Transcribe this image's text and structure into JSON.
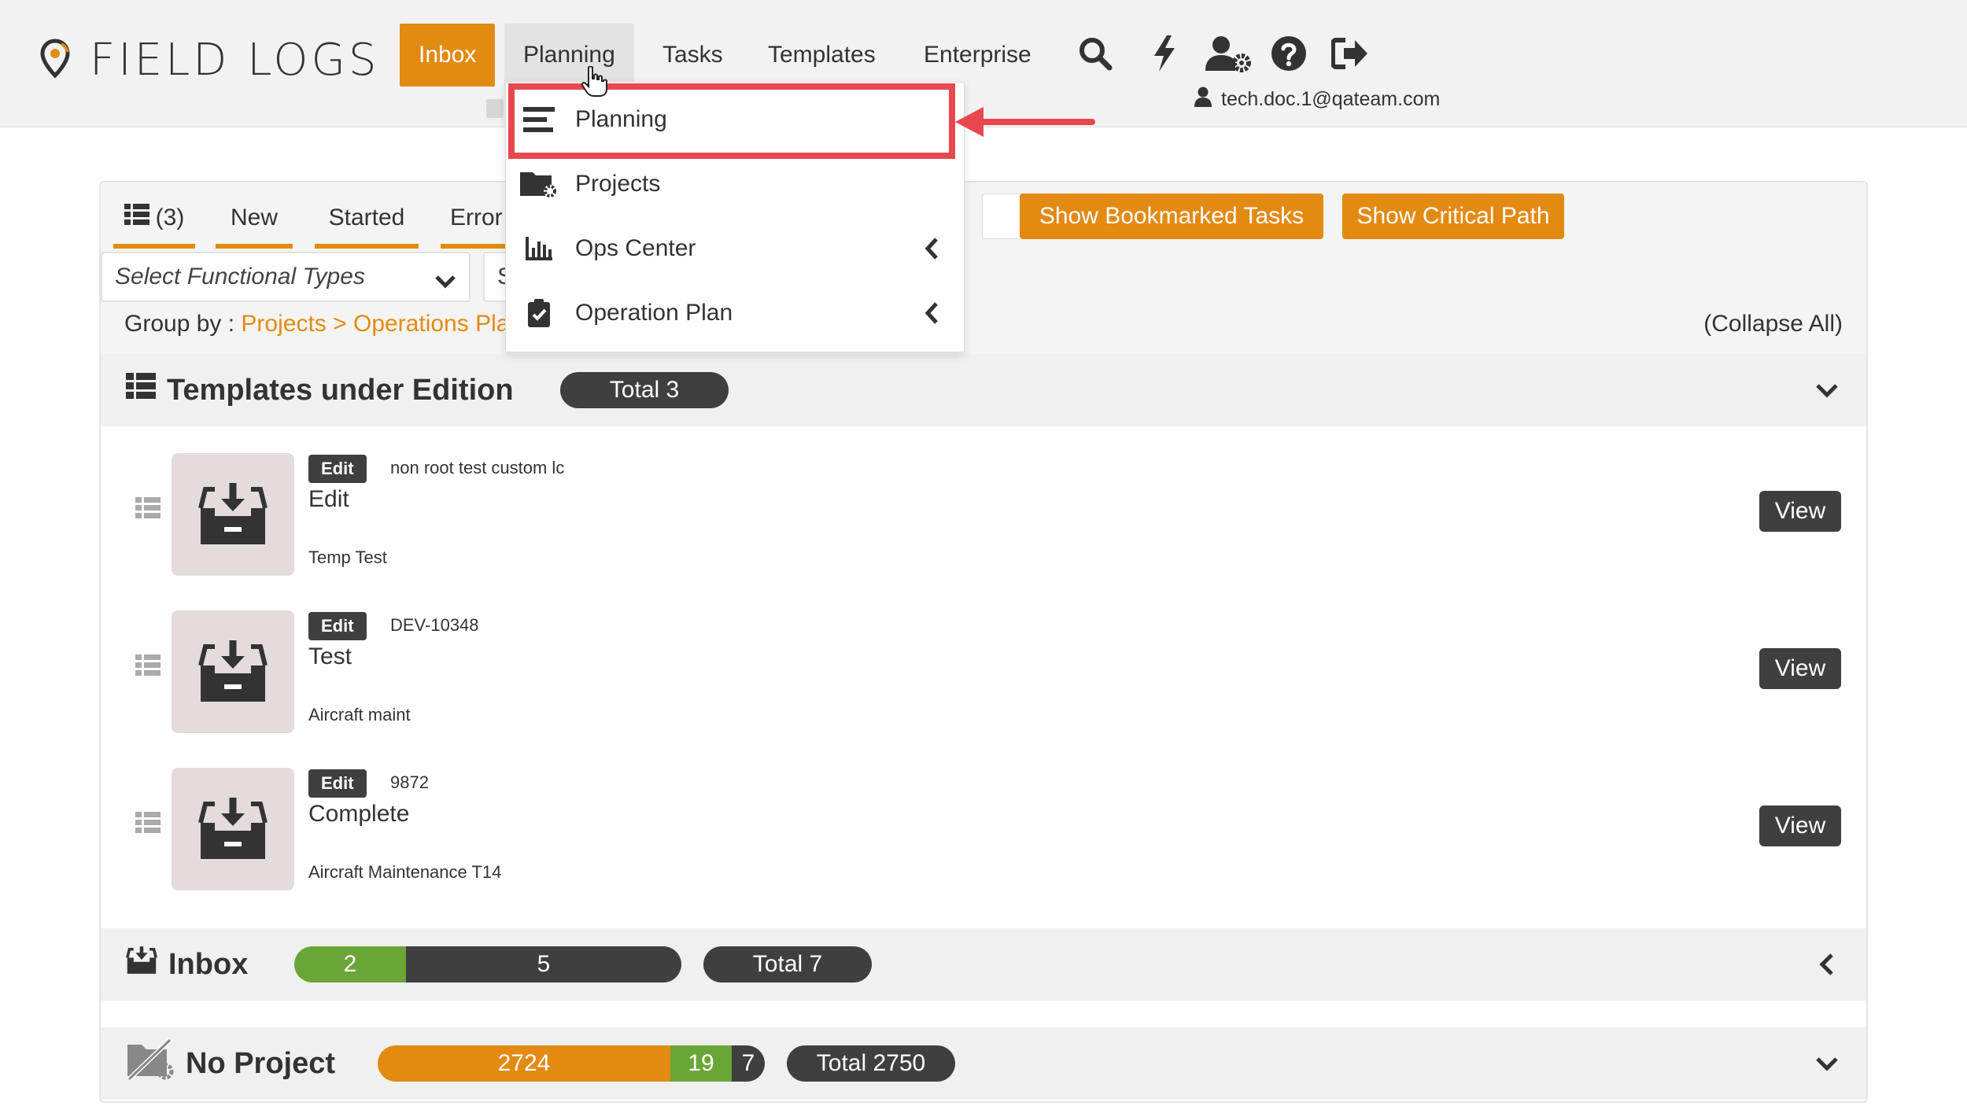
{
  "header": {
    "logo_text": "FIELD LOGS",
    "nav": [
      "Inbox",
      "Planning",
      "Tasks",
      "Templates",
      "Enterprise"
    ],
    "active_nav": "Inbox",
    "hover_nav": "Planning",
    "icons": [
      "search-icon",
      "lightning-icon",
      "user-gear-icon",
      "help-icon",
      "logout-icon"
    ],
    "user_email": "tech.doc.1@qateam.com"
  },
  "dropdown": {
    "items": [
      {
        "label": "Planning",
        "icon": "bars-icon",
        "submenu": false
      },
      {
        "label": "Projects",
        "icon": "folder-gear-icon",
        "submenu": false
      },
      {
        "label": "Ops Center",
        "icon": "bar-chart-icon",
        "submenu": true
      },
      {
        "label": "Operation Plan",
        "icon": "clipboard-check-icon",
        "submenu": true
      }
    ]
  },
  "toolbar": {
    "list_count": "(3)",
    "tabs": [
      "New",
      "Started",
      "Error"
    ],
    "bookmarked_button": "Show Bookmarked Tasks",
    "critical_path_button": "Show Critical Path",
    "functional_types_placeholder": "Select Functional Types",
    "second_select_text": "S",
    "group_by_label": "Group by :",
    "group_by_path": "Projects > Operations Pla",
    "collapse_all": "(Collapse All)"
  },
  "sections": {
    "templates": {
      "title": "Templates under Edition",
      "total": "Total 3",
      "rows": [
        {
          "badge": "Edit",
          "code": "non root test custom lc",
          "title": "Edit",
          "subtitle": "Temp Test",
          "view": "View"
        },
        {
          "badge": "Edit",
          "code": "DEV-10348",
          "title": "Test",
          "subtitle": "Aircraft maint",
          "view": "View"
        },
        {
          "badge": "Edit",
          "code": "9872",
          "title": "Complete",
          "subtitle": "Aircraft Maintenance T14",
          "view": "View"
        }
      ]
    },
    "inbox": {
      "title": "Inbox",
      "progress": [
        {
          "value": "2",
          "color": "#6aa637"
        },
        {
          "value": "5",
          "color": "#3f3f3f"
        }
      ],
      "total": "Total 7"
    },
    "no_project": {
      "title": "No Project",
      "progress": [
        {
          "value": "2724",
          "color": "#e38a12"
        },
        {
          "value": "19",
          "color": "#6aa637"
        },
        {
          "value": "7",
          "color": "#3f3f3f"
        }
      ],
      "total": "Total 2750"
    }
  },
  "colors": {
    "accent": "#e38a12",
    "dark": "#3f3f3f",
    "green": "#6aa637",
    "highlight": "#e8474f"
  }
}
